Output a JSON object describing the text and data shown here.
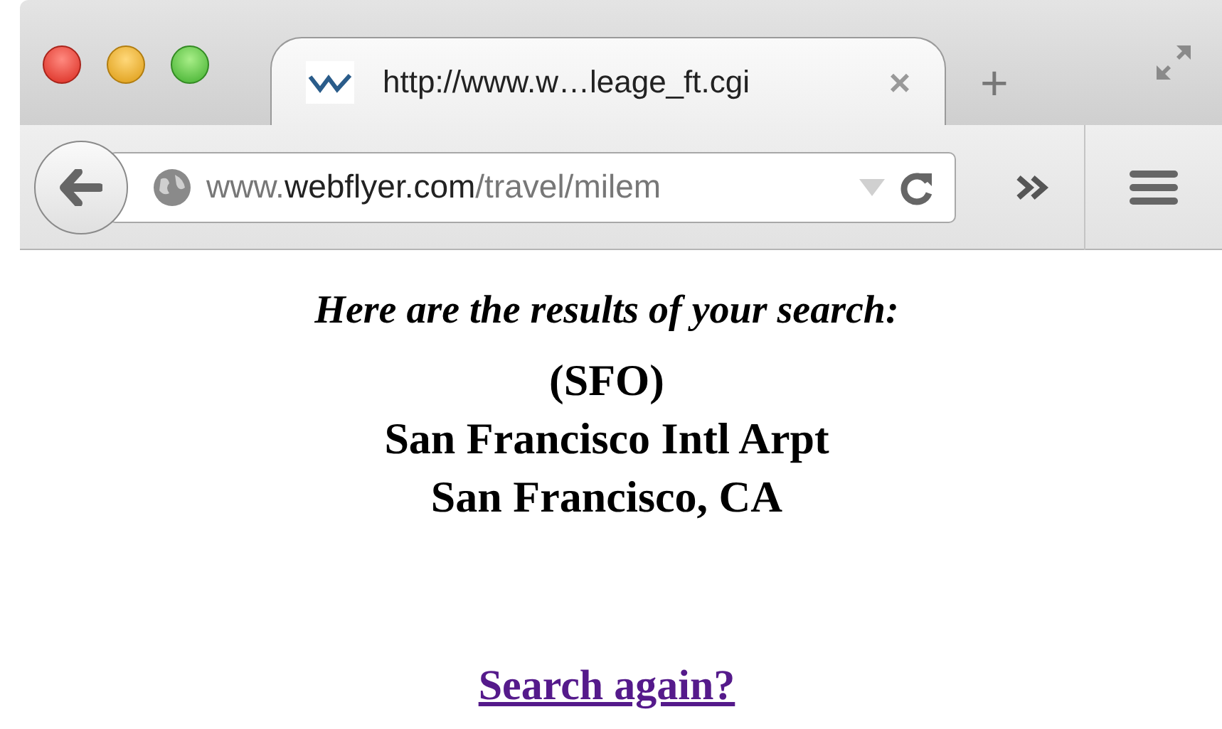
{
  "tab": {
    "title": "http://www.w…leage_ft.cgi",
    "close": "×",
    "new_tab": "+",
    "selected": true
  },
  "address_bar": {
    "prefix": "www.",
    "domain": "webflyer.com",
    "path": "/travel/milem"
  },
  "content": {
    "heading": "Here are the results of your search:",
    "lines": [
      "(SFO)",
      "San Francisco Intl Arpt",
      "San Francisco, CA"
    ],
    "link": {
      "text": "Search again?",
      "visited": true
    }
  }
}
